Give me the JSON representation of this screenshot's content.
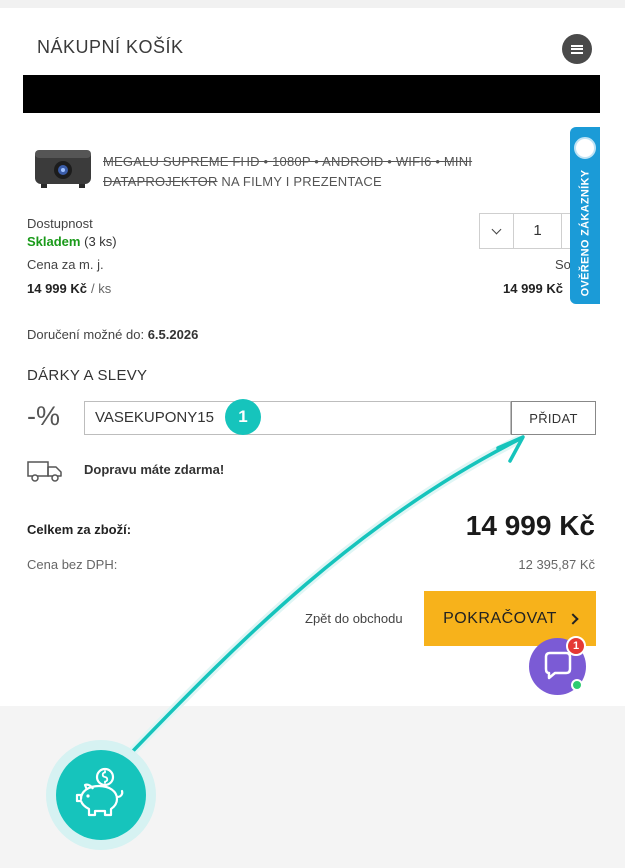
{
  "header": {
    "title": "NÁKUPNÍ KOŠÍK"
  },
  "product": {
    "name_strike": "MEGALU SUPREME FHD • 1080P • ANDROID • WIFI6 • MINI DATAPROJEKTOR",
    "name_rest": "NA FILMY I PREZENTACE",
    "availability_label": "Dostupnost",
    "availability_status": "Skladem",
    "availability_count": "(3 ks)",
    "unit_price_label": "Cena za m. j.",
    "unit_price": "14 999 Kč",
    "unit_price_unit": "/ ks",
    "quantity": "1",
    "sum_label": "So",
    "sum_price": "14 999 Kč"
  },
  "verified_tab": {
    "text": "OVĚŘENO ZÁKAZNÍKY"
  },
  "delivery": {
    "label": "Doručení možné do:",
    "date": "6.5.2026"
  },
  "gifts": {
    "title": "DÁRKY A SLEVY",
    "percent_glyph": "-%",
    "coupon_value": "VASEKUPONY15",
    "add_button": "PŘIDAT",
    "step_number": "1"
  },
  "shipping": {
    "text": "Dopravu máte zdarma!"
  },
  "totals": {
    "label": "Celkem za zboží:",
    "value": "14 999 Kč",
    "vat_label": "Cena bez DPH:",
    "vat_value": "12 395,87 Kč"
  },
  "actions": {
    "back": "Zpět do obchodu",
    "continue": "POKRAČOVAT"
  },
  "chat": {
    "notifications": "1"
  },
  "colors": {
    "accent_teal": "#16c4bc",
    "continue_yellow": "#f7b21b",
    "stock_green": "#1a9a1a",
    "verified_blue": "#1b9bd7",
    "chat_purple": "#7b5bd5"
  },
  "icons": [
    "hamburger-menu-icon",
    "chevron-down-icon",
    "truck-icon",
    "chevron-right-icon",
    "chat-bubble-icon",
    "piggy-bank-icon",
    "verified-badge-icon"
  ]
}
